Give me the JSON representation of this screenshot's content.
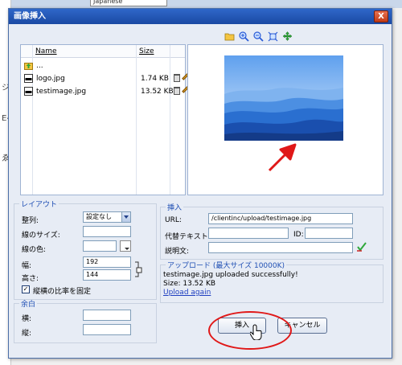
{
  "background": {
    "language_select": "Japanese",
    "frag_a": "ジ",
    "frag_b": "Eへ",
    "frag_c": "ゑ"
  },
  "dialog": {
    "title": "画像挿入",
    "close_label": "X",
    "toolbar_icons": [
      "folder-icon",
      "zoom-in-icon",
      "zoom-out-icon",
      "fit-icon",
      "move-icon"
    ],
    "file_list": {
      "columns": {
        "name": "Name",
        "size": "Size"
      },
      "rows": [
        {
          "name": "...",
          "size": "",
          "icon": "folder-up-icon"
        },
        {
          "name": "logo.jpg",
          "size": "1.74 KB",
          "icon": "image-file-icon"
        },
        {
          "name": "testimage.jpg",
          "size": "13.52 KB",
          "icon": "image-file-icon"
        }
      ]
    },
    "layout": {
      "legend": "レイアウト",
      "align_label": "整列:",
      "align_value": "設定なし",
      "border_size_label": "線のサイズ:",
      "border_size_value": "",
      "border_color_label": "線の色:",
      "width_label": "幅:",
      "width_value": "192",
      "height_label": "高さ:",
      "height_value": "144",
      "keep_ratio_label": "縦横の比率を固定",
      "keep_ratio_checked": true
    },
    "margin": {
      "legend": "余白",
      "horizontal_label": "横:",
      "vertical_label": "縦:"
    },
    "insert": {
      "legend": "挿入",
      "url_label": "URL:",
      "url_value": "/clientinc/upload/testimage.jpg",
      "alt_label": "代替テキスト:",
      "id_label": "ID:",
      "desc_label": "説明文:"
    },
    "upload": {
      "legend": "アップロード (最大サイズ 10000K)",
      "message": "testimage.jpg uploaded successfully!",
      "size_line": "Size: 13.52 KB",
      "again_link": "Upload again"
    },
    "buttons": {
      "insert": "挿入",
      "cancel": "キャンセル"
    }
  }
}
